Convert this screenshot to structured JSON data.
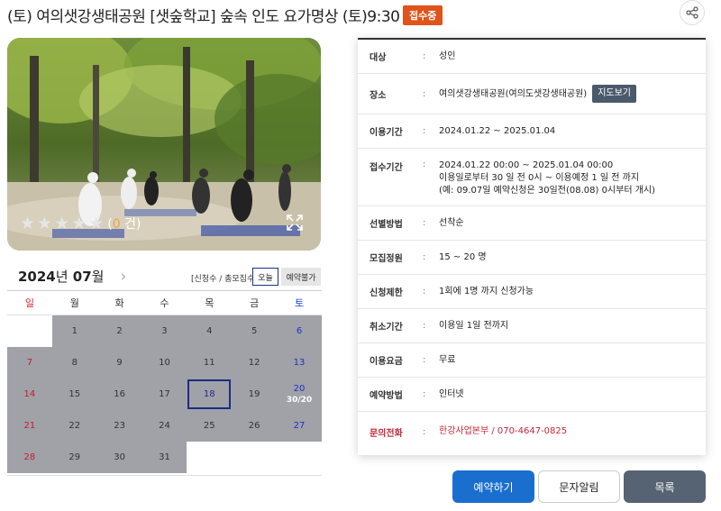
{
  "header": {
    "title": "(토) 여의샛강생태공원 [샛숲학교] 숲속 인도 요가명상 (토)9:30",
    "status_badge": "접수중",
    "share_icon": "share-icon"
  },
  "photo": {
    "rating_stars": 5,
    "rating_count_open": "(",
    "rating_count_value": "0",
    "rating_count_close": " 건)",
    "expand_icon": "expand-icon"
  },
  "calendar": {
    "year": "2024",
    "year_unit": "년",
    "month": "07",
    "month_unit": "월",
    "next_icon": "chevron-right-icon",
    "legend": "[신청수 / 총모집수]",
    "today_label": "오늘",
    "unavailable_label": "예약불가",
    "weekdays": [
      "일",
      "월",
      "화",
      "수",
      "목",
      "금",
      "토"
    ],
    "weeks": [
      [
        "",
        "1",
        "2",
        "3",
        "4",
        "5",
        "6"
      ],
      [
        "7",
        "8",
        "9",
        "10",
        "11",
        "12",
        "13"
      ],
      [
        "14",
        "15",
        "16",
        "17",
        "18",
        "19",
        "20"
      ],
      [
        "21",
        "22",
        "23",
        "24",
        "25",
        "26",
        "27"
      ],
      [
        "28",
        "29",
        "30",
        "31",
        "",
        "",
        ""
      ]
    ],
    "today_day": "18",
    "counts": {
      "20": "30/20"
    }
  },
  "info": [
    {
      "label": "대상",
      "colon": ":",
      "lines": [
        "성인"
      ]
    },
    {
      "label": "장소",
      "colon": ":",
      "lines": [
        "여의샛강생태공원(여의도샛강생태공원)"
      ],
      "button": "지도보기"
    },
    {
      "label": "이용기간",
      "colon": ":",
      "lines": [
        "2024.01.22 ~ 2025.01.04"
      ]
    },
    {
      "label": "접수기간",
      "colon": ":",
      "lines": [
        "2024.01.22 00:00 ~ 2025.01.04 00:00",
        "이용일로부터 30 일 전 0시 ~ 이용예정 1 일 전 까지",
        "(예: 09.07일 예약신청은 30일전(08.08) 0시부터 개시)"
      ]
    },
    {
      "label": "선별방법",
      "colon": ":",
      "lines": [
        "선착순"
      ]
    },
    {
      "label": "모집정원",
      "colon": ":",
      "lines": [
        "15 ~ 20 명"
      ]
    },
    {
      "label": "신청제한",
      "colon": ":",
      "lines": [
        "1회에 1명 까지 신청가능"
      ]
    },
    {
      "label": "취소기간",
      "colon": ":",
      "lines": [
        "이용일 1일 전까지"
      ]
    },
    {
      "label": "이용요금",
      "colon": ":",
      "lines": [
        "무료"
      ]
    },
    {
      "label": "예약방법",
      "colon": ":",
      "lines": [
        "인터넷"
      ]
    },
    {
      "label": "문의전화",
      "colon": ":",
      "lines": [
        "한강사업본부 / 070-4647-0825"
      ],
      "red": true
    }
  ],
  "buttons": {
    "reserve": "예약하기",
    "sms": "문자알림",
    "list": "목록"
  }
}
